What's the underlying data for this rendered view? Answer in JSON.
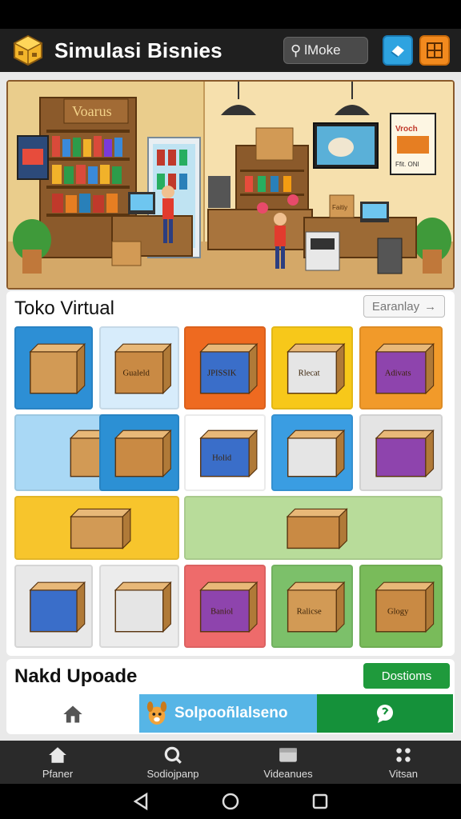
{
  "app": {
    "title": "Simulasi Bisnies",
    "search_text": "lMoke"
  },
  "hero": {
    "shop_sign": "Voarus",
    "poster_title": "Vroch",
    "poster_caption": "Ffit. ONI",
    "note_card": "Faitiy"
  },
  "store_section": {
    "title": "Toko Virtual",
    "see_all": "Earanlay",
    "tiles": [
      {
        "label": "",
        "bg": "#2d8fd5"
      },
      {
        "label": "Gualeld",
        "bg": "#d7ecfb"
      },
      {
        "label": "JPISSIK",
        "bg": "#ee6a20"
      },
      {
        "label": "Rlecat",
        "bg": "#f7c81a"
      },
      {
        "label": "Adivats",
        "bg": "#f19a2a"
      },
      {
        "label": "",
        "bg": "#a9d8f5"
      },
      {
        "label": "",
        "bg": "#2c90d4"
      },
      {
        "label": "Holid",
        "bg": "#ffffff"
      },
      {
        "label": "",
        "bg": "#3a9de2"
      },
      {
        "label": "",
        "bg": "#e4e4e4"
      },
      {
        "label": "",
        "bg": "#f7c52c"
      },
      {
        "label": "",
        "bg": "#b8dc9a"
      },
      {
        "label": "",
        "bg": "#e8e8e8"
      },
      {
        "label": "",
        "bg": "#ececec"
      },
      {
        "label": "Baniol",
        "bg": "#ee6b6b"
      },
      {
        "label": "Ralicse",
        "bg": "#7cc06a"
      },
      {
        "label": "Glogy",
        "bg": "#79bb5a"
      }
    ]
  },
  "update_section": {
    "title": "Nakd Upoade",
    "button": "Dostioms",
    "banner_text": "Solpooñlalseno"
  },
  "bottom_nav": [
    {
      "label": "Pfaner",
      "icon": "home-icon"
    },
    {
      "label": "Sodiojpanp",
      "icon": "search-icon"
    },
    {
      "label": "Videanues",
      "icon": "folder-icon"
    },
    {
      "label": "Vitsan",
      "icon": "grid-dots-icon"
    }
  ],
  "colors": {
    "appbar": "#1f1f1f",
    "accent_blue": "#2ea3e0",
    "accent_orange": "#f28a1e",
    "green": "#1f9a3c"
  }
}
